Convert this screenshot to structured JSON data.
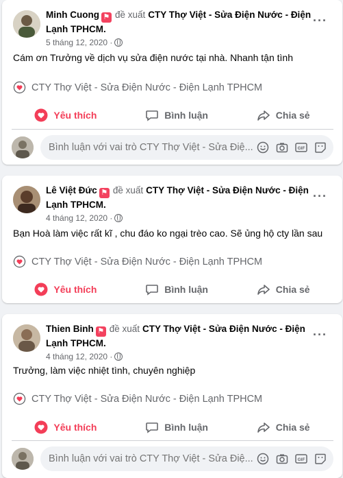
{
  "posts": [
    {
      "author": "Minh Cuong",
      "verb": "đề xuất",
      "page": "CTY Thợ Việt - Sửa Điện Nước - Điện Lạnh TPHCM.",
      "date": "5 tháng 12, 2020 ·",
      "text": "Cám ơn Trưởng về dịch vụ sửa điện nước tại nhà. Nhanh tận tình",
      "page_link": "CTY Thợ Việt - Sửa Điện Nước - Điện Lạnh TPHCM",
      "has_comment_box": true
    },
    {
      "author": "Lê Việt Đức",
      "verb": "đề xuất",
      "page": "CTY Thợ Việt - Sửa Điện Nước - Điện Lạnh TPHCM.",
      "date": "4 tháng 12, 2020 ·",
      "text": "Bạn Hoà làm việc rất kĩ , chu đáo ko ngại trèo cao. Sẽ ủng hộ cty lần sau",
      "page_link": "CTY Thợ Việt - Sửa Điện Nước - Điện Lạnh TPHCM",
      "has_comment_box": false
    },
    {
      "author": "Thien Binh",
      "verb": "đề xuất",
      "page": "CTY Thợ Việt - Sửa Điện Nước - Điện Lạnh TPHCM.",
      "date": "4 tháng 12, 2020 ·",
      "text": "Trưởng, làm việc nhiệt tình, chuyên nghiệp",
      "page_link": "CTY Thợ Việt - Sửa Điện Nước - Điện Lạnh TPHCM",
      "has_comment_box": true
    }
  ],
  "actions": {
    "like": "Yêu thích",
    "comment": "Bình luận",
    "share": "Chia sẻ"
  },
  "comment_box": {
    "placeholder": "Bình luận với vai trò CTY Thợ Việt - Sửa Điệ..."
  },
  "colors": {
    "like_red": "#f33e58",
    "badge": "#f3425f",
    "muted": "#65676b"
  }
}
